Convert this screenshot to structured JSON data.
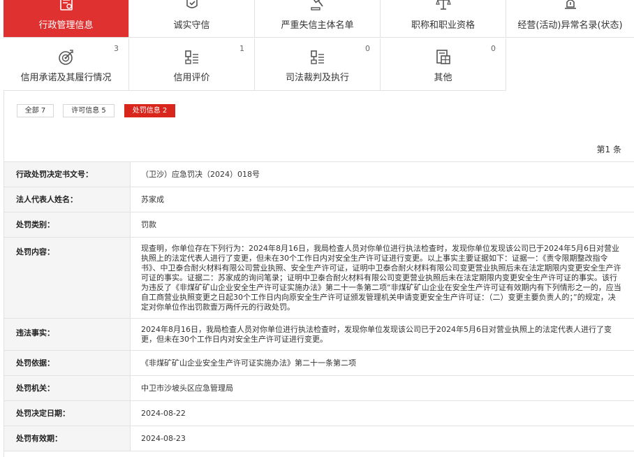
{
  "tabs": [
    {
      "label": "行政管理信息",
      "count": "",
      "icon": "document-seal-icon",
      "active": true
    },
    {
      "label": "诚实守信",
      "count": "",
      "icon": "trust-badge-icon",
      "active": false
    },
    {
      "label": "严重失信主体名单",
      "count": "",
      "icon": "gavel-icon",
      "active": false
    },
    {
      "label": "职称和职业资格",
      "count": "",
      "icon": "scales-icon",
      "active": false
    },
    {
      "label": "经营(活动)异常名录(状态)",
      "count": "",
      "icon": "alarm-light-icon",
      "active": false
    },
    {
      "label": "信用承诺及其履行情况",
      "count": "3",
      "icon": "target-icon",
      "active": false
    },
    {
      "label": "信用评价",
      "count": "1",
      "icon": "trophy-list-icon",
      "active": false
    },
    {
      "label": "司法裁判及执行",
      "count": "0",
      "icon": "court-list-icon",
      "active": false
    },
    {
      "label": "其他",
      "count": "0",
      "icon": "grid-document-icon",
      "active": false
    }
  ],
  "filters": [
    {
      "label": "全部 7"
    },
    {
      "label": "许可信息 5"
    },
    {
      "label": "处罚信息 2"
    }
  ],
  "record_no": "第1 条",
  "detail": {
    "doc_no_label": "行政处罚决定书文号：",
    "doc_no": "（卫沙）应急罚决（2024）018号",
    "rep_label": "法人代表人姓名：",
    "rep": "苏家成",
    "type_label": "处罚类别：",
    "type": "罚款",
    "content_label": "处罚内容：",
    "content": "现查明，你单位存在下列行为：2024年8月16日，我局检查人员对你单位进行执法检查时，发现你单位发现该公司已于2024年5月6日对营业执照上的法定代表人进行了变更，但未在30个工作日内对安全生产许可证进行变更。以上事实主要证据如下：证据一：《责令限期整改指令书》、中卫泰合耐火材料有限公司营业执照、安全生产许可证，证明中卫泰合耐火材料有限公司变更营业执照后未在法定期限内变更安全生产许可证的事实。证据二：苏家成的询问笔录；证明中卫泰合耐火材料有限公司变更营业执照后未在法定期限内变更安全生产许可证的事实。该行为违反了《非煤矿矿山企业安全生产许可证实施办法》第二十一条第二项“非煤矿矿山企业在安全生产许可证有效期内有下列情形之一的，应当自工商营业执照变更之日起30个工作日内向原安全生产许可证颁发管理机关申请变更安全生产许可证：（二）变更主要负责人的；”的规定，决定对你单位作出罚款壹万两仟元的行政处罚。",
    "fact_label": "违法事实：",
    "fact": "2024年8月16日，我局检查人员对你单位进行执法检查时，发现你单位发现该公司已于2024年5月6日对营业执照上的法定代表人进行了变更，但未在30个工作日内对安全生产许可证进行变更。",
    "basis_label": "处罚依据：",
    "basis": "《非煤矿矿山企业安全生产许可证实施办法》第二十一条第二项",
    "org_label": "处罚机关：",
    "org": "中卫市沙坡头区应急管理局",
    "date_label": "处罚决定日期：",
    "date": "2024-08-22",
    "valid_label": "处罚有效期：",
    "valid": "2024-08-23"
  },
  "colors": {
    "accent": "#e03131",
    "filter_active": "#d9261c",
    "label_bg": "#f5f5f5",
    "border": "#e2e2e2"
  }
}
